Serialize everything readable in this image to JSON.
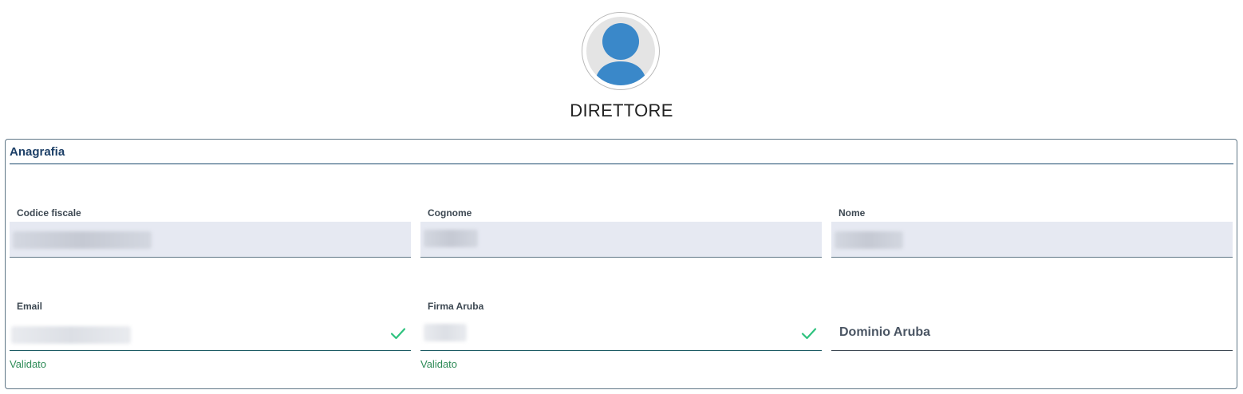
{
  "profile": {
    "avatar_icon": "user-avatar-icon",
    "role": "DIRETTORE"
  },
  "card": {
    "title": "Anagrafia"
  },
  "fields": {
    "codice_fiscale": {
      "label": "Codice fiscale"
    },
    "cognome": {
      "label": "Cognome"
    },
    "nome": {
      "label": "Nome"
    },
    "email": {
      "label": "Email",
      "status": "Validato",
      "status_icon": "check-icon"
    },
    "firma_aruba": {
      "label": "Firma Aruba",
      "status": "Validato",
      "status_icon": "check-icon"
    },
    "dominio_aruba": {
      "placeholder": "Dominio Aruba"
    }
  },
  "colors": {
    "accent": "#1c3f67",
    "avatar": "#3a88c9",
    "valid": "#2ec27e",
    "valid_text": "#2e8b57",
    "readonly_bg": "#e6e9f2"
  }
}
